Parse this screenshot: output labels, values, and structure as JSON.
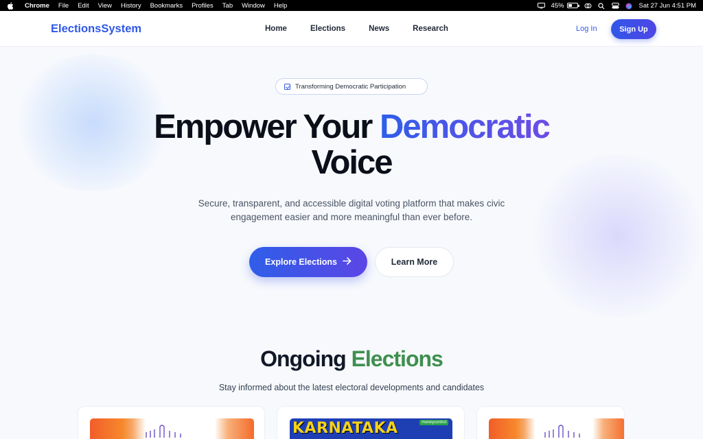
{
  "menubar": {
    "app": "Chrome",
    "items": [
      "File",
      "Edit",
      "View",
      "History",
      "Bookmarks",
      "Profiles",
      "Tab",
      "Window",
      "Help"
    ],
    "battery": "45%",
    "battery_level": 0.45,
    "datetime": "Sat 27 Jun  4:51 PM"
  },
  "nav": {
    "logo": "ElectionsSystem",
    "links": [
      "Home",
      "Elections",
      "News",
      "Research"
    ],
    "login": "Log In",
    "signup": "Sign Up"
  },
  "hero": {
    "badge": "Transforming Democratic Participation",
    "headline_part1": "Empower Your ",
    "headline_accent": "Democratic",
    "headline_part2": "Voice",
    "subtext": "Secure, transparent, and accessible digital voting platform that makes civic engagement easier and more meaningful than ever before.",
    "primary_button": "Explore Elections",
    "secondary_button": "Learn More"
  },
  "elections": {
    "title_part1": "Ongoing ",
    "title_accent": "Elections",
    "subtitle": "Stay informed about the latest electoral developments and candidates",
    "card2_banner": "KARNATAKA",
    "card2_badge": "moneycontrol"
  },
  "colors": {
    "brand": "#2f58e8",
    "accent_green": "#3f8f4f"
  }
}
